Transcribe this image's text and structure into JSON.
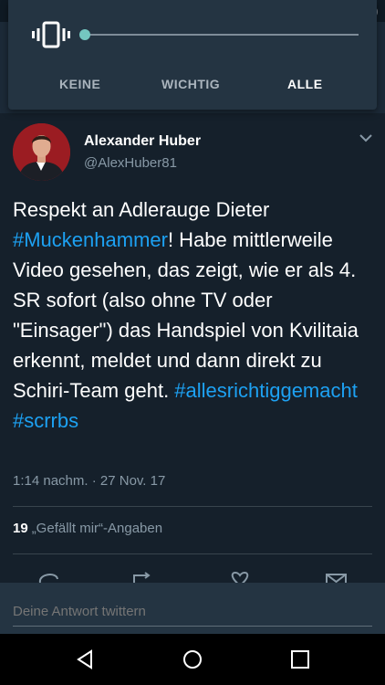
{
  "notification_panel": {
    "modes": [
      "KEINE",
      "WICHTIG",
      "ALLE"
    ],
    "selected_mode": "ALLE",
    "volume_level": 0
  },
  "tweet": {
    "author_name": "Alexander Huber",
    "author_handle": "@AlexHuber81",
    "text_parts": [
      "Respekt an Adlerauge Dieter ",
      "#Muckenhammer",
      "! Habe mittlerweile Video gesehen, das zeigt, wie er als 4. SR sofort (also ohne TV oder \"Einsager\") das Handspiel von Kvilitaia erkennt, meldet und dann direkt zu Schiri-Team geht. ",
      "#allesrichtiggemacht",
      " ",
      "#scrrbs"
    ],
    "timestamp": "1:14 nachm. · 27 Nov. 17",
    "likes_count": "19",
    "likes_label": "„Gefällt mir“-Angaben"
  },
  "reply": {
    "placeholder": "Deine Antwort twittern"
  },
  "colors": {
    "background": "#15202b",
    "hashtag": "#1da1f2",
    "slider_thumb": "#74c7c0"
  }
}
